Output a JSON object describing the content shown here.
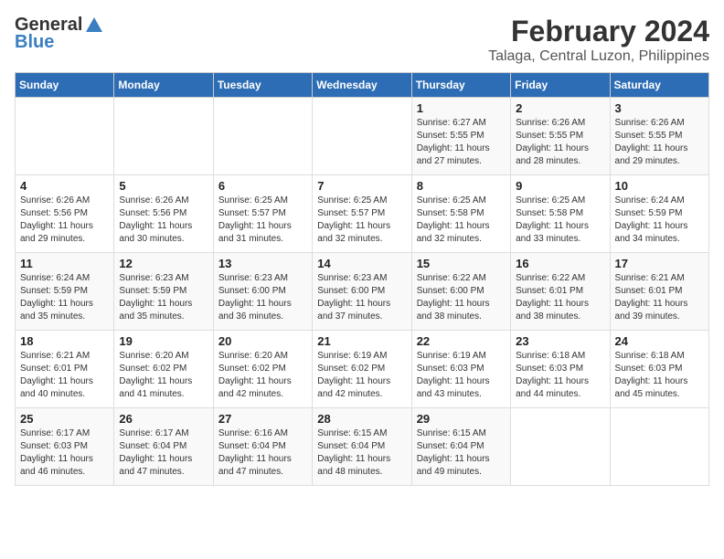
{
  "app": {
    "logo_general": "General",
    "logo_blue": "Blue"
  },
  "header": {
    "month": "February 2024",
    "location": "Talaga, Central Luzon, Philippines"
  },
  "weekdays": [
    "Sunday",
    "Monday",
    "Tuesday",
    "Wednesday",
    "Thursday",
    "Friday",
    "Saturday"
  ],
  "weeks": [
    [
      {
        "day": "",
        "sunrise": "",
        "sunset": "",
        "daylight": ""
      },
      {
        "day": "",
        "sunrise": "",
        "sunset": "",
        "daylight": ""
      },
      {
        "day": "",
        "sunrise": "",
        "sunset": "",
        "daylight": ""
      },
      {
        "day": "",
        "sunrise": "",
        "sunset": "",
        "daylight": ""
      },
      {
        "day": "1",
        "sunrise": "Sunrise: 6:27 AM",
        "sunset": "Sunset: 5:55 PM",
        "daylight": "Daylight: 11 hours and 27 minutes."
      },
      {
        "day": "2",
        "sunrise": "Sunrise: 6:26 AM",
        "sunset": "Sunset: 5:55 PM",
        "daylight": "Daylight: 11 hours and 28 minutes."
      },
      {
        "day": "3",
        "sunrise": "Sunrise: 6:26 AM",
        "sunset": "Sunset: 5:55 PM",
        "daylight": "Daylight: 11 hours and 29 minutes."
      }
    ],
    [
      {
        "day": "4",
        "sunrise": "Sunrise: 6:26 AM",
        "sunset": "Sunset: 5:56 PM",
        "daylight": "Daylight: 11 hours and 29 minutes."
      },
      {
        "day": "5",
        "sunrise": "Sunrise: 6:26 AM",
        "sunset": "Sunset: 5:56 PM",
        "daylight": "Daylight: 11 hours and 30 minutes."
      },
      {
        "day": "6",
        "sunrise": "Sunrise: 6:25 AM",
        "sunset": "Sunset: 5:57 PM",
        "daylight": "Daylight: 11 hours and 31 minutes."
      },
      {
        "day": "7",
        "sunrise": "Sunrise: 6:25 AM",
        "sunset": "Sunset: 5:57 PM",
        "daylight": "Daylight: 11 hours and 32 minutes."
      },
      {
        "day": "8",
        "sunrise": "Sunrise: 6:25 AM",
        "sunset": "Sunset: 5:58 PM",
        "daylight": "Daylight: 11 hours and 32 minutes."
      },
      {
        "day": "9",
        "sunrise": "Sunrise: 6:25 AM",
        "sunset": "Sunset: 5:58 PM",
        "daylight": "Daylight: 11 hours and 33 minutes."
      },
      {
        "day": "10",
        "sunrise": "Sunrise: 6:24 AM",
        "sunset": "Sunset: 5:59 PM",
        "daylight": "Daylight: 11 hours and 34 minutes."
      }
    ],
    [
      {
        "day": "11",
        "sunrise": "Sunrise: 6:24 AM",
        "sunset": "Sunset: 5:59 PM",
        "daylight": "Daylight: 11 hours and 35 minutes."
      },
      {
        "day": "12",
        "sunrise": "Sunrise: 6:23 AM",
        "sunset": "Sunset: 5:59 PM",
        "daylight": "Daylight: 11 hours and 35 minutes."
      },
      {
        "day": "13",
        "sunrise": "Sunrise: 6:23 AM",
        "sunset": "Sunset: 6:00 PM",
        "daylight": "Daylight: 11 hours and 36 minutes."
      },
      {
        "day": "14",
        "sunrise": "Sunrise: 6:23 AM",
        "sunset": "Sunset: 6:00 PM",
        "daylight": "Daylight: 11 hours and 37 minutes."
      },
      {
        "day": "15",
        "sunrise": "Sunrise: 6:22 AM",
        "sunset": "Sunset: 6:00 PM",
        "daylight": "Daylight: 11 hours and 38 minutes."
      },
      {
        "day": "16",
        "sunrise": "Sunrise: 6:22 AM",
        "sunset": "Sunset: 6:01 PM",
        "daylight": "Daylight: 11 hours and 38 minutes."
      },
      {
        "day": "17",
        "sunrise": "Sunrise: 6:21 AM",
        "sunset": "Sunset: 6:01 PM",
        "daylight": "Daylight: 11 hours and 39 minutes."
      }
    ],
    [
      {
        "day": "18",
        "sunrise": "Sunrise: 6:21 AM",
        "sunset": "Sunset: 6:01 PM",
        "daylight": "Daylight: 11 hours and 40 minutes."
      },
      {
        "day": "19",
        "sunrise": "Sunrise: 6:20 AM",
        "sunset": "Sunset: 6:02 PM",
        "daylight": "Daylight: 11 hours and 41 minutes."
      },
      {
        "day": "20",
        "sunrise": "Sunrise: 6:20 AM",
        "sunset": "Sunset: 6:02 PM",
        "daylight": "Daylight: 11 hours and 42 minutes."
      },
      {
        "day": "21",
        "sunrise": "Sunrise: 6:19 AM",
        "sunset": "Sunset: 6:02 PM",
        "daylight": "Daylight: 11 hours and 42 minutes."
      },
      {
        "day": "22",
        "sunrise": "Sunrise: 6:19 AM",
        "sunset": "Sunset: 6:03 PM",
        "daylight": "Daylight: 11 hours and 43 minutes."
      },
      {
        "day": "23",
        "sunrise": "Sunrise: 6:18 AM",
        "sunset": "Sunset: 6:03 PM",
        "daylight": "Daylight: 11 hours and 44 minutes."
      },
      {
        "day": "24",
        "sunrise": "Sunrise: 6:18 AM",
        "sunset": "Sunset: 6:03 PM",
        "daylight": "Daylight: 11 hours and 45 minutes."
      }
    ],
    [
      {
        "day": "25",
        "sunrise": "Sunrise: 6:17 AM",
        "sunset": "Sunset: 6:03 PM",
        "daylight": "Daylight: 11 hours and 46 minutes."
      },
      {
        "day": "26",
        "sunrise": "Sunrise: 6:17 AM",
        "sunset": "Sunset: 6:04 PM",
        "daylight": "Daylight: 11 hours and 47 minutes."
      },
      {
        "day": "27",
        "sunrise": "Sunrise: 6:16 AM",
        "sunset": "Sunset: 6:04 PM",
        "daylight": "Daylight: 11 hours and 47 minutes."
      },
      {
        "day": "28",
        "sunrise": "Sunrise: 6:15 AM",
        "sunset": "Sunset: 6:04 PM",
        "daylight": "Daylight: 11 hours and 48 minutes."
      },
      {
        "day": "29",
        "sunrise": "Sunrise: 6:15 AM",
        "sunset": "Sunset: 6:04 PM",
        "daylight": "Daylight: 11 hours and 49 minutes."
      },
      {
        "day": "",
        "sunrise": "",
        "sunset": "",
        "daylight": ""
      },
      {
        "day": "",
        "sunrise": "",
        "sunset": "",
        "daylight": ""
      }
    ]
  ]
}
